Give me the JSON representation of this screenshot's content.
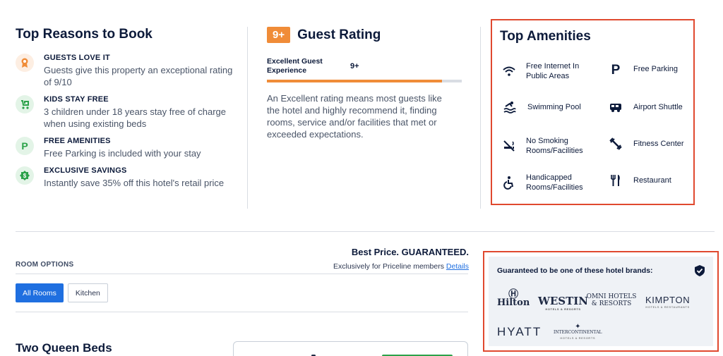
{
  "reasons": {
    "title": "Top Reasons to Book",
    "items": [
      {
        "title": "GUESTS LOVE IT",
        "desc": "Guests give this property an exceptional rating of 9/10",
        "icon": "award-icon",
        "color": "#f08c38",
        "bg": "#fdeee2"
      },
      {
        "title": "KIDS STAY FREE",
        "desc": "3 children under 18 years stay free of charge when using existing beds",
        "icon": "stroller-icon",
        "color": "#2ca24a",
        "bg": "#e3f4e7"
      },
      {
        "title": "FREE AMENITIES",
        "desc": "Free Parking is included with your stay",
        "icon": "parking-icon",
        "color": "#2ca24a",
        "bg": "#e3f4e7"
      },
      {
        "title": "EXCLUSIVE SAVINGS",
        "desc": "Instantly save 35% off this hotel's retail price",
        "icon": "savings-icon",
        "color": "#2ca24a",
        "bg": "#e3f4e7"
      }
    ]
  },
  "rating": {
    "badge": "9+",
    "title": "Guest Rating",
    "label": "Excellent Guest Experience",
    "score": "9+",
    "fill_fraction": 0.9,
    "desc": "An Excellent rating means most guests like the hotel and highly recommend it, finding rooms, service and/or facilities that met or exceeded expectations."
  },
  "amenities": {
    "title": "Top Amenities",
    "items": [
      {
        "label": "Free Internet In Public Areas",
        "icon": "wifi-icon"
      },
      {
        "label": "Free Parking",
        "icon": "parking-icon"
      },
      {
        "label": "Swimming Pool",
        "icon": "pool-icon"
      },
      {
        "label": "Airport Shuttle",
        "icon": "shuttle-icon"
      },
      {
        "label": "No Smoking Rooms/Facilities",
        "icon": "no-smoking-icon"
      },
      {
        "label": "Fitness Center",
        "icon": "fitness-icon"
      },
      {
        "label": "Handicapped Rooms/Facilities",
        "icon": "accessible-icon"
      },
      {
        "label": "Restaurant",
        "icon": "restaurant-icon"
      }
    ]
  },
  "room_options": {
    "label": "ROOM OPTIONS",
    "best_price": "Best Price. GUARANTEED.",
    "members_text": "Exclusively for Priceline members",
    "details_link": "Details",
    "tabs": [
      "All Rooms",
      "Kitchen"
    ],
    "room_title": "Two Queen Beds"
  },
  "brands": {
    "title": "Guaranteed to be one of these hotel brands:",
    "logos": [
      {
        "name": "Hilton",
        "sub": ""
      },
      {
        "name": "WESTIN",
        "sub": "HOTELS & RESORTS"
      },
      {
        "name": "OMNI HOTELS & RESORTS",
        "sub": ""
      },
      {
        "name": "KIMPTON",
        "sub": "HOTELS & RESTAURANTS"
      },
      {
        "name": "HYATT",
        "sub": ""
      },
      {
        "name": "INTERCONTINENTAL",
        "sub": "HOTELS & RESORTS"
      }
    ]
  },
  "colors": {
    "accent": "#f08c38",
    "green": "#2ca24a",
    "blue": "#1f6fe0",
    "highlight": "#e0492f"
  }
}
